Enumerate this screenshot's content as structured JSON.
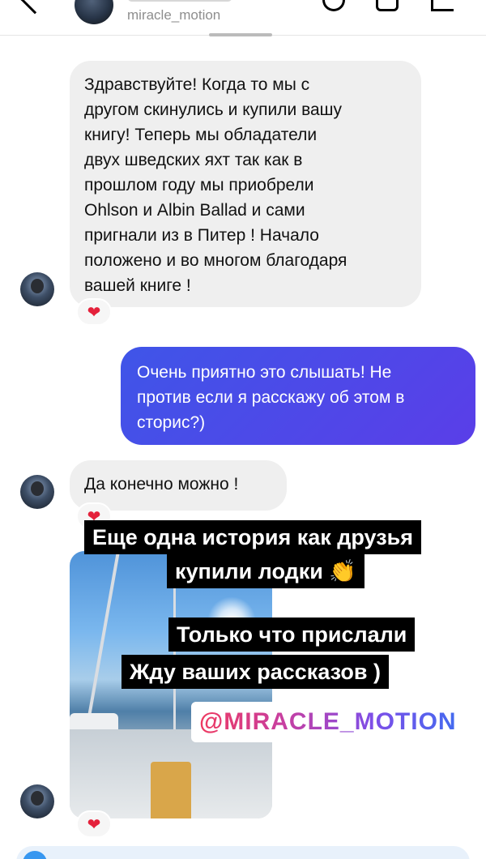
{
  "header": {
    "username": "miracle_motion",
    "icons": {
      "back": "chevron-left-icon",
      "phone": "phone-icon",
      "video": "video-camera-icon",
      "info": "info-icon"
    }
  },
  "messages": [
    {
      "from": "them",
      "text": "Здравствуйте! Когда то мы с\nдругом скинулись и купили вашу\nкнигу! Теперь мы обладатели\nдвух шведских яхт так как в\nпрошлом году мы приобрели\nOhlson и Albin Ballad и сами\nпригнали из в Питер ! Начало\nположено и во многом благодаря\nвашей книге !",
      "reaction": "❤"
    },
    {
      "from": "me",
      "text": "Очень приятно это слышать! Не\nпротив если я расскажу об этом в\nсторис?)"
    },
    {
      "from": "them",
      "text": "Да конечно можно !",
      "reaction": "❤"
    },
    {
      "from": "them",
      "type": "story",
      "reaction": "❤"
    }
  ],
  "story_overlay": {
    "line1": "Еще одна история как друзья",
    "line2": "купили лодки 👏",
    "line3": "Только что прислали",
    "line4": "Жду ваших рассказов )",
    "handle": "@MIRACLE_MOTION"
  },
  "colors": {
    "outgoing_start": "#3f55e8",
    "outgoing_end": "#5a3ee8",
    "incoming": "#efefef",
    "heart": "#e4213b"
  }
}
